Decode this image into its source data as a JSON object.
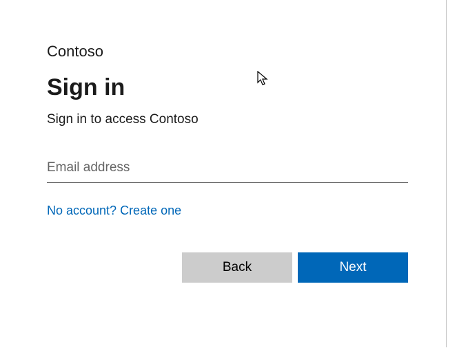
{
  "brand": "Contoso",
  "title": "Sign in",
  "subtitle": "Sign in to access Contoso",
  "email": {
    "value": "",
    "placeholder": "Email address"
  },
  "create_account_link": "No account? Create one",
  "buttons": {
    "back": "Back",
    "next": "Next"
  },
  "colors": {
    "primary": "#0067b8",
    "secondary": "#cccccc",
    "text": "#1b1b1b"
  }
}
